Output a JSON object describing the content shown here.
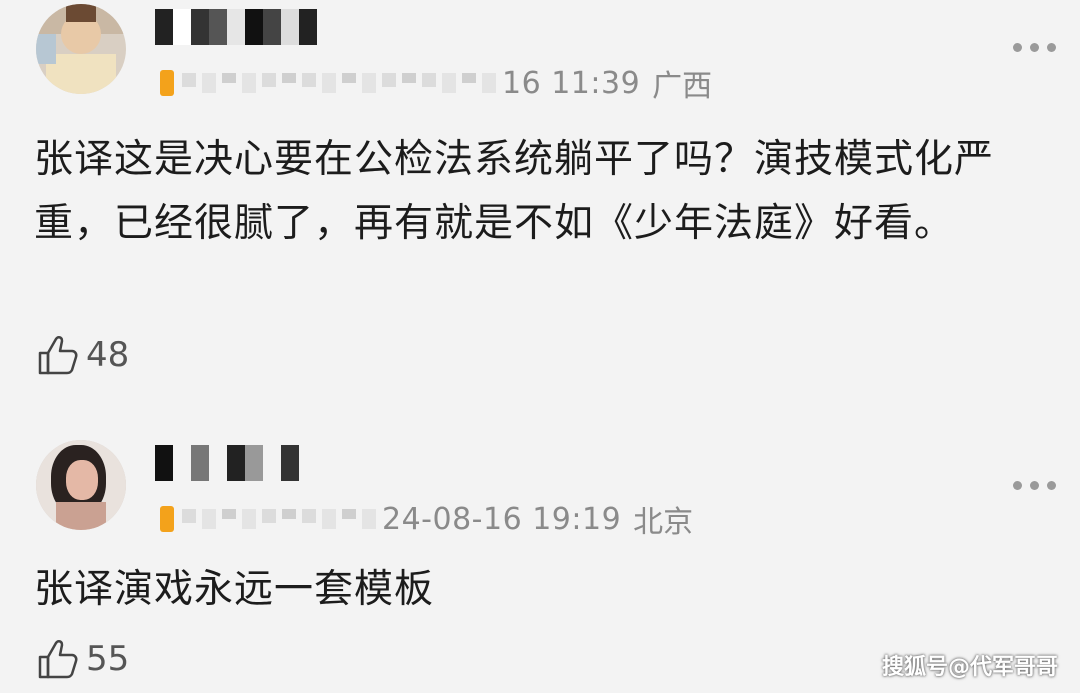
{
  "comments": [
    {
      "username_obscured": true,
      "time": "16 11:39",
      "location": "广西",
      "text": "张译这是决心要在公检法系统躺平了吗？演技模式化严重，已经很腻了，再有就是不如《少年法庭》好看。",
      "likes": "48"
    },
    {
      "username_obscured": true,
      "time": "24-08-16 19:19",
      "location": "北京",
      "text": "张译演戏永远一套模板",
      "likes": "55"
    }
  ],
  "watermark": "搜狐号@代军哥哥",
  "colors": {
    "background": "#f3f3f3",
    "badge": "#f3a21b",
    "meta": "#8a8a8a"
  },
  "icons": {
    "more": "more-dots-icon",
    "like": "thumbs-up-icon"
  }
}
